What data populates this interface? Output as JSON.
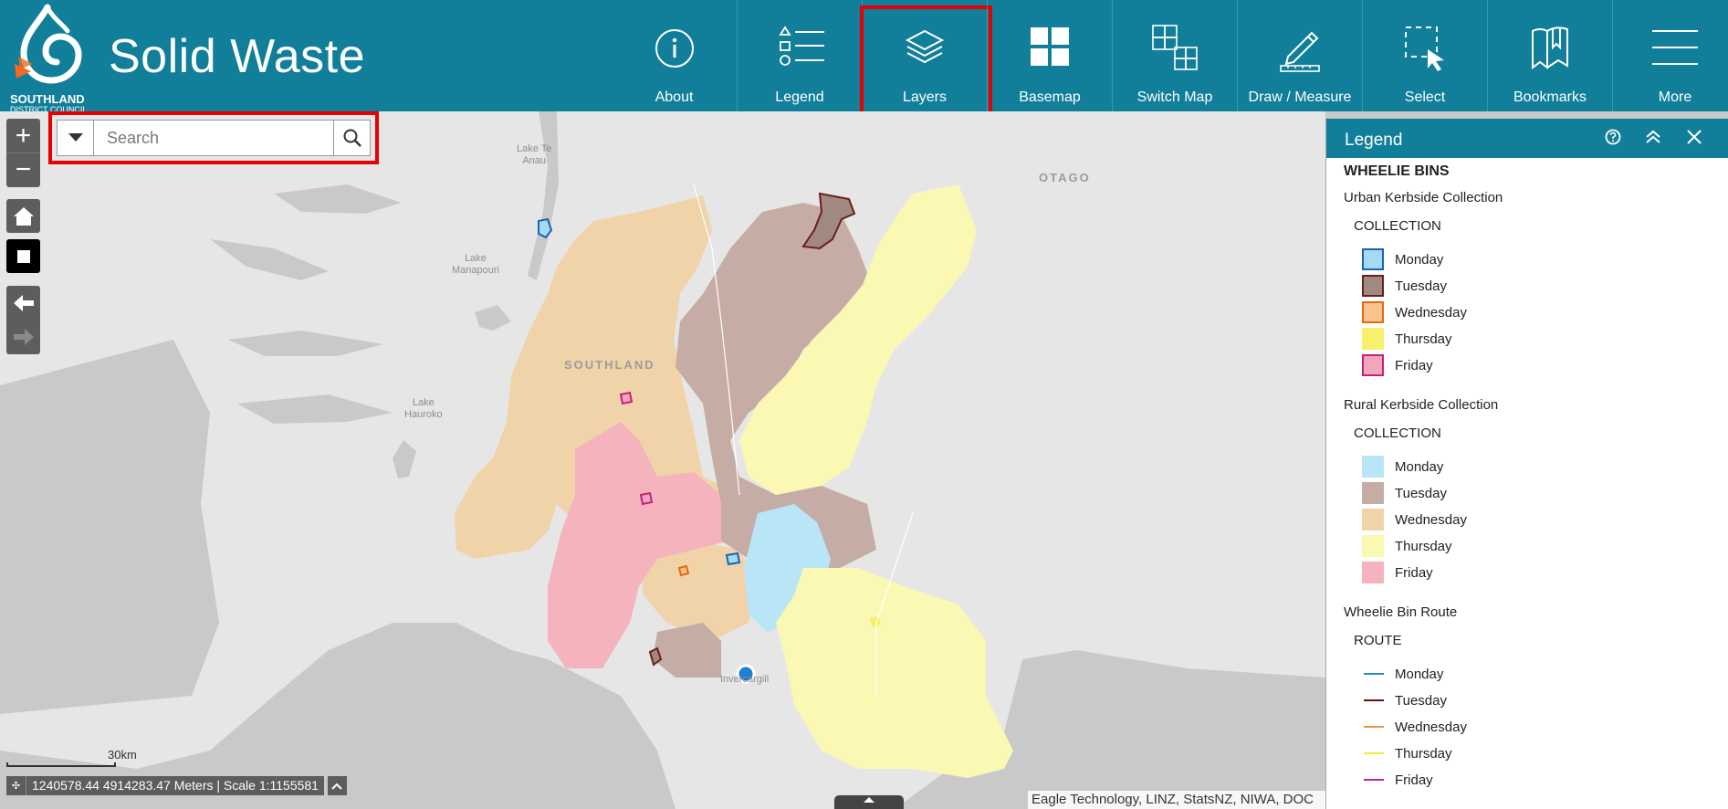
{
  "brand": {
    "title": "Solid Waste",
    "council_line1": "SOUTHLAND",
    "council_line2": "DISTRICT COUNCIL"
  },
  "toolbar": [
    {
      "id": "about",
      "label": "About",
      "icon": "info-icon"
    },
    {
      "id": "legend",
      "label": "Legend",
      "icon": "legend-icon"
    },
    {
      "id": "layers",
      "label": "Layers",
      "icon": "layers-icon",
      "highlighted": true
    },
    {
      "id": "basemap",
      "label": "Basemap",
      "icon": "basemap-icon"
    },
    {
      "id": "switch_map",
      "label": "Switch Map",
      "icon": "switch-map-icon"
    },
    {
      "id": "draw_measure",
      "label": "Draw / Measure",
      "icon": "pencil-ruler-icon"
    },
    {
      "id": "select",
      "label": "Select",
      "icon": "select-icon"
    },
    {
      "id": "bookmarks",
      "label": "Bookmarks",
      "icon": "bookmark-icon"
    },
    {
      "id": "more",
      "label": "More",
      "icon": "menu-icon"
    }
  ],
  "search": {
    "placeholder": "Search",
    "value": ""
  },
  "map": {
    "place_labels": {
      "lake_te_anau": "Lake Te\nAnau",
      "lake_manapouri": "Lake\nManapouri",
      "lake_hauroko": "Lake\nHauroko",
      "invercargill": "Invercargill",
      "southland": "SOUTHLAND",
      "otago": "OTAGO"
    },
    "scale_label": "30km",
    "coordinates_text": "1240578.44 4914283.47 Meters | Scale 1:1155581",
    "attribution": "Eagle Technology, LINZ, StatsNZ, NIWA, DOC"
  },
  "legend": {
    "title": "Legend",
    "layer_title": "WHEELIE BINS",
    "groups": [
      {
        "name": "Urban Kerbside Collection",
        "field": "COLLECTION",
        "type": "polygon",
        "items": [
          {
            "label": "Monday",
            "fill": "#a6d9f2",
            "stroke": "#1a63b5"
          },
          {
            "label": "Tuesday",
            "fill": "#a08a80",
            "stroke": "#6e1d1d"
          },
          {
            "label": "Wednesday",
            "fill": "#f8c38c",
            "stroke": "#e86a10"
          },
          {
            "label": "Thursday",
            "fill": "#f7f06c",
            "stroke": "#f7f06c"
          },
          {
            "label": "Friday",
            "fill": "#f2a6bd",
            "stroke": "#c2227d"
          }
        ]
      },
      {
        "name": "Rural Kerbside Collection",
        "field": "COLLECTION",
        "type": "polygon",
        "items": [
          {
            "label": "Monday",
            "fill": "#b9e6f7",
            "stroke": "#b9e6f7"
          },
          {
            "label": "Tuesday",
            "fill": "#c5ada5",
            "stroke": "#c5ada5"
          },
          {
            "label": "Wednesday",
            "fill": "#f0d3a8",
            "stroke": "#f0d3a8"
          },
          {
            "label": "Thursday",
            "fill": "#fbf8b4",
            "stroke": "#fbf8b4"
          },
          {
            "label": "Friday",
            "fill": "#f4b3bd",
            "stroke": "#f4b3bd"
          }
        ]
      },
      {
        "name": "Wheelie Bin Route",
        "field": "ROUTE",
        "type": "line",
        "items": [
          {
            "label": "Monday",
            "stroke": "#2a8fb8"
          },
          {
            "label": "Tuesday",
            "stroke": "#6b0f0f"
          },
          {
            "label": "Wednesday",
            "stroke": "#e89a3a"
          },
          {
            "label": "Thursday",
            "stroke": "#f2ee3a"
          },
          {
            "label": "Friday",
            "stroke": "#c0249a"
          }
        ]
      }
    ]
  },
  "colors": {
    "header_bg": "#117f99",
    "highlight": "#e60000",
    "land": "#e6e6e6",
    "water": "#c9c9c9"
  }
}
